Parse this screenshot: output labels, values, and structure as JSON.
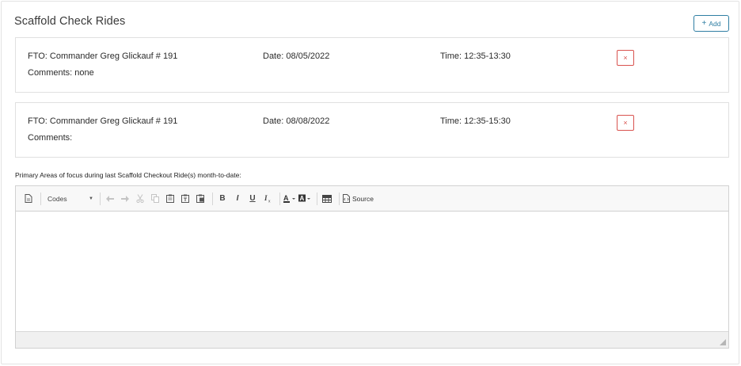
{
  "section": {
    "title": "Scaffold Check Rides",
    "add_label": "Add",
    "add_icon": "plus-icon"
  },
  "rides": [
    {
      "fto": "FTO: Commander Greg Glickauf # 191",
      "date": "Date: 08/05/2022",
      "time": "Time: 12:35-13:30",
      "comments": "Comments: none",
      "delete_glyph": "×"
    },
    {
      "fto": "FTO: Commander Greg Glickauf # 191",
      "date": "Date: 08/08/2022",
      "time": "Time: 12:35-15:30",
      "comments": "Comments:",
      "delete_glyph": "×"
    }
  ],
  "focus": {
    "label": "Primary Areas of focus during last Scaffold Checkout Ride(s) month-to-date:"
  },
  "editor": {
    "format_combo": "Codes",
    "bold": "B",
    "italic": "I",
    "underline": "U",
    "remove_format": "Ix",
    "text_color": "A",
    "bg_color": "A",
    "source_label": "Source",
    "content": ""
  },
  "colors": {
    "accent": "#2f7ea3",
    "danger": "#d9534f",
    "toolbar_bg": "#f8f8f8"
  }
}
